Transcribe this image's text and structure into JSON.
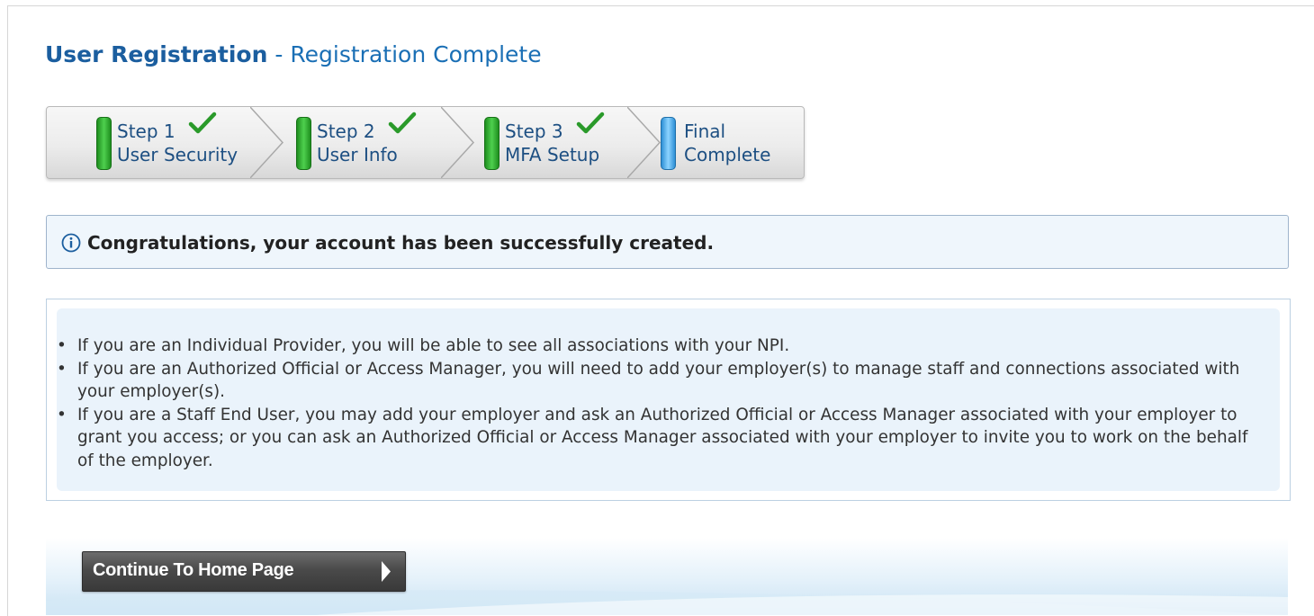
{
  "header": {
    "title_main": "User Registration",
    "title_separator": "-",
    "title_sub": "Registration Complete"
  },
  "steps": [
    {
      "line1": "Step 1",
      "line2": "User Security",
      "status": "complete",
      "indicator_color": "#2fb52f",
      "icon": "checkmark-icon"
    },
    {
      "line1": "Step 2",
      "line2": "User Info",
      "status": "complete",
      "indicator_color": "#2fb52f",
      "icon": "checkmark-icon"
    },
    {
      "line1": "Step 3",
      "line2": "MFA Setup",
      "status": "complete",
      "indicator_color": "#2fb52f",
      "icon": "checkmark-icon"
    },
    {
      "line1": "Final",
      "line2": "Complete",
      "status": "current",
      "indicator_color": "#4fb3f0"
    }
  ],
  "alert": {
    "icon": "info-icon",
    "message": "Congratulations, your account has been successfully created."
  },
  "info_list": {
    "bullet": "•",
    "items": [
      "If you are an Individual Provider, you will be able to see all associations with your NPI.",
      "If you are an Authorized Official or Access Manager, you will need to add your employer(s) to manage staff and connections associated with your employer(s).",
      "If you are a Staff End User, you may add your employer and ask an Authorized Official or Access Manager associated with your employer to grant you access; or you can ask an Authorized Official or Access Manager associated with your employer to invite you to work on the behalf of the employer."
    ]
  },
  "actions": {
    "continue_label": "Continue To Home Page",
    "continue_icon": "chevron-right-icon"
  },
  "colors": {
    "title_blue": "#1b5e9f",
    "alert_bg": "#eff6fc",
    "panel_bg": "#eaf3fb",
    "button_bg": "#4a4a4a"
  }
}
